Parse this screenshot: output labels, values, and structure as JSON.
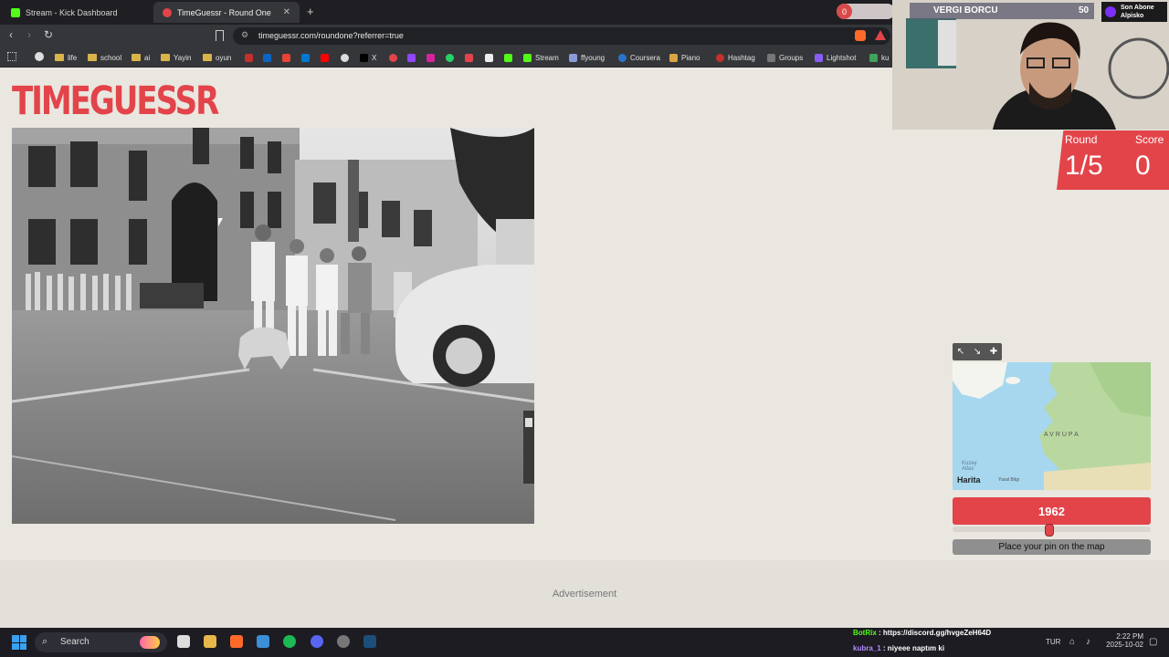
{
  "browser": {
    "tabs": [
      {
        "title": "Stream - Kick Dashboard",
        "active": false
      },
      {
        "title": "TimeGuessr - Round One",
        "active": true
      }
    ],
    "url": "timeguessr.com/roundone?referrer=true",
    "bookmarks": [
      "life",
      "school",
      "ai",
      "Yayin",
      "oyun",
      "X",
      "Stream",
      "ffyoung",
      "Coursera",
      "Piano",
      "Hashtag",
      "Groups",
      "Lightshot",
      "ku"
    ]
  },
  "game": {
    "logo": "TIMEGUESSR",
    "round_label": "Round",
    "round_value": "1/5",
    "score_label": "Score",
    "score_value": "0",
    "map_label_europe": "AVRUPA",
    "map_label_atlantic": "Kuzey Atlas",
    "map_brand": "Harita",
    "map_legal": "Yasal Bilgi",
    "year": "1962",
    "year_slider_fraction": 0.49,
    "pin_button": "Place your pin on the map",
    "advertisement": "Advertisement"
  },
  "stream_overlay": {
    "notification_count": "0",
    "tax_label": "VERGI BORCU",
    "tax_value": "50",
    "last_sub_title": "Son Abone",
    "last_sub_name": "Alpisko"
  },
  "taskbar": {
    "search_label": "Search",
    "chat": [
      {
        "user": "BotRix",
        "message": ": https://discord.gg/hvgeZeH64D"
      },
      {
        "user": "kubra_1",
        "message": ": niyeee naptım ki"
      }
    ],
    "language": "TUR",
    "time": "2:22 PM",
    "date": "2025-10-02"
  },
  "colors": {
    "accent": "#e2444a",
    "page_bg": "#e9e7df",
    "chrome_dark": "#1f1f23"
  }
}
